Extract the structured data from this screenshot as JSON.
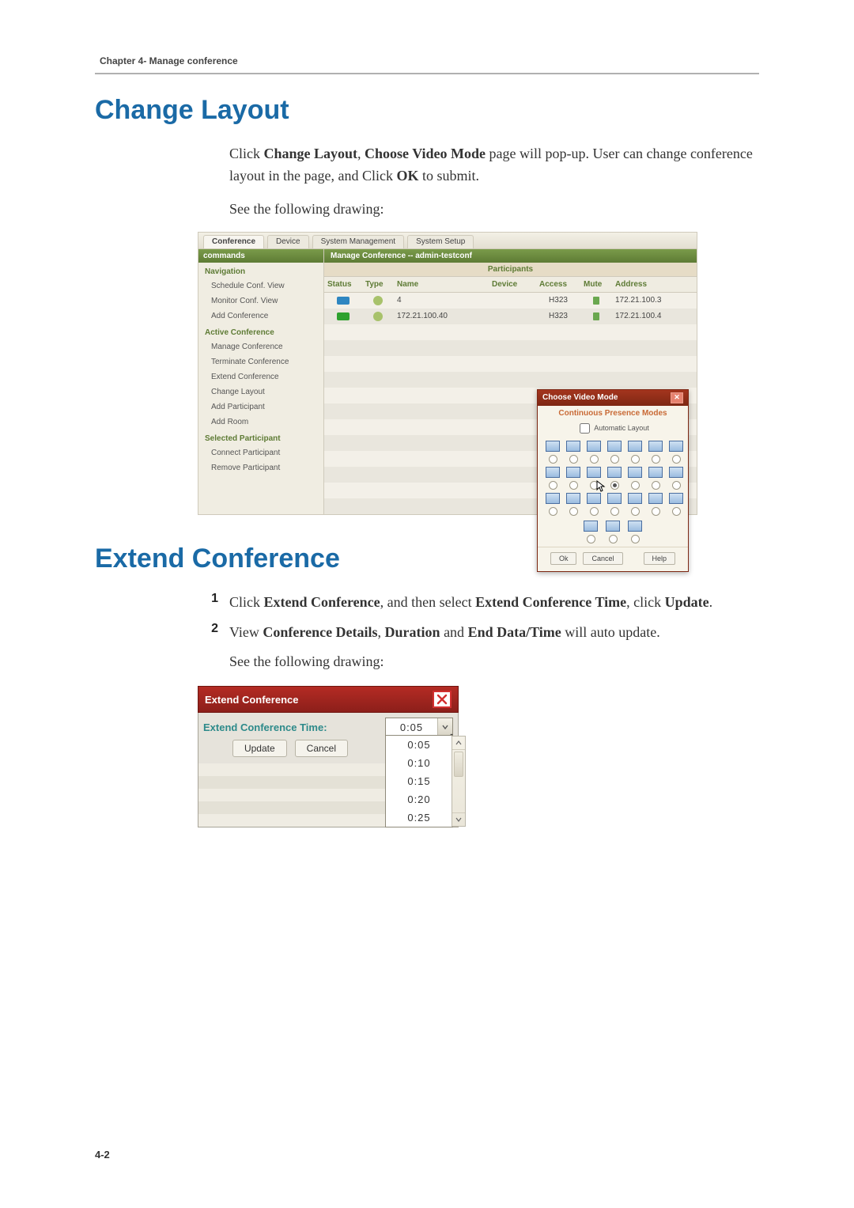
{
  "running_head": "Chapter 4- Manage conference",
  "section1": {
    "title": "Change Layout",
    "para1_pre": "Click ",
    "para1_b1": "Change Layout",
    "para1_mid1": ", ",
    "para1_b2": "Choose Video Mode",
    "para1_mid2": " page will pop-up. User can change conference layout in the page, and Click ",
    "para1_b3": "OK",
    "para1_post": " to submit.",
    "para2": "See the following drawing:"
  },
  "app1": {
    "tabs": [
      "Conference",
      "Device",
      "System Management",
      "System Setup"
    ],
    "sidebar": {
      "commands_head": "commands",
      "nav_section": "Navigation",
      "nav_items": [
        "Schedule Conf. View",
        "Monitor Conf. View",
        "Add Conference"
      ],
      "active_section": "Active Conference",
      "active_items": [
        "Manage Conference",
        "Terminate Conference",
        "Extend Conference",
        "Change Layout",
        "Add Participant",
        "Add Room"
      ],
      "selpart_section": "Selected Participant",
      "selpart_items": [
        "Connect Participant",
        "Remove Participant"
      ]
    },
    "content_title": "Manage Conference -- admin-testconf",
    "participants_head": "Participants",
    "columns": [
      "Status",
      "Type",
      "Name",
      "Device",
      "Access",
      "Mute",
      "Address"
    ],
    "rows": [
      {
        "status_color": "#2e86c1",
        "type_color": "#8aa84a",
        "name": "4",
        "device": "",
        "access": "H323",
        "mute_on": true,
        "address": "172.21.100.3"
      },
      {
        "status_color": "#2ea12e",
        "type_color": "#8aa84a",
        "name": "172.21.100.40",
        "device": "",
        "access": "H323",
        "mute_on": true,
        "address": "172.21.100.4"
      }
    ],
    "modal": {
      "title": "Choose Video Mode",
      "subhead": "Continuous Presence Modes",
      "auto_label": "Automatic Layout",
      "selected_index": 10,
      "ok": "Ok",
      "cancel": "Cancel",
      "help": "Help"
    }
  },
  "section2": {
    "title": "Extend Conference",
    "items": [
      {
        "num": "1",
        "pre": "Click ",
        "b1": "Extend Conference",
        "mid1": ", and then select ",
        "b2": "Extend Conference Time",
        "mid2": ", click ",
        "b3": "Update",
        "post": "."
      },
      {
        "num": "2",
        "pre": "View ",
        "b1": "Conference Details",
        "mid1": ", ",
        "b2": "Duration",
        "mid2": " and ",
        "b3": "End Data/Time",
        "post": " will auto update."
      }
    ],
    "see": "See the following drawing:"
  },
  "app2": {
    "title": "Extend Conference",
    "label": "Extend Conference Time:",
    "selected": "0:05",
    "options": [
      "0:05",
      "0:10",
      "0:15",
      "0:20",
      "0:25"
    ],
    "update": "Update",
    "cancel": "Cancel"
  },
  "page_num": "4-2"
}
